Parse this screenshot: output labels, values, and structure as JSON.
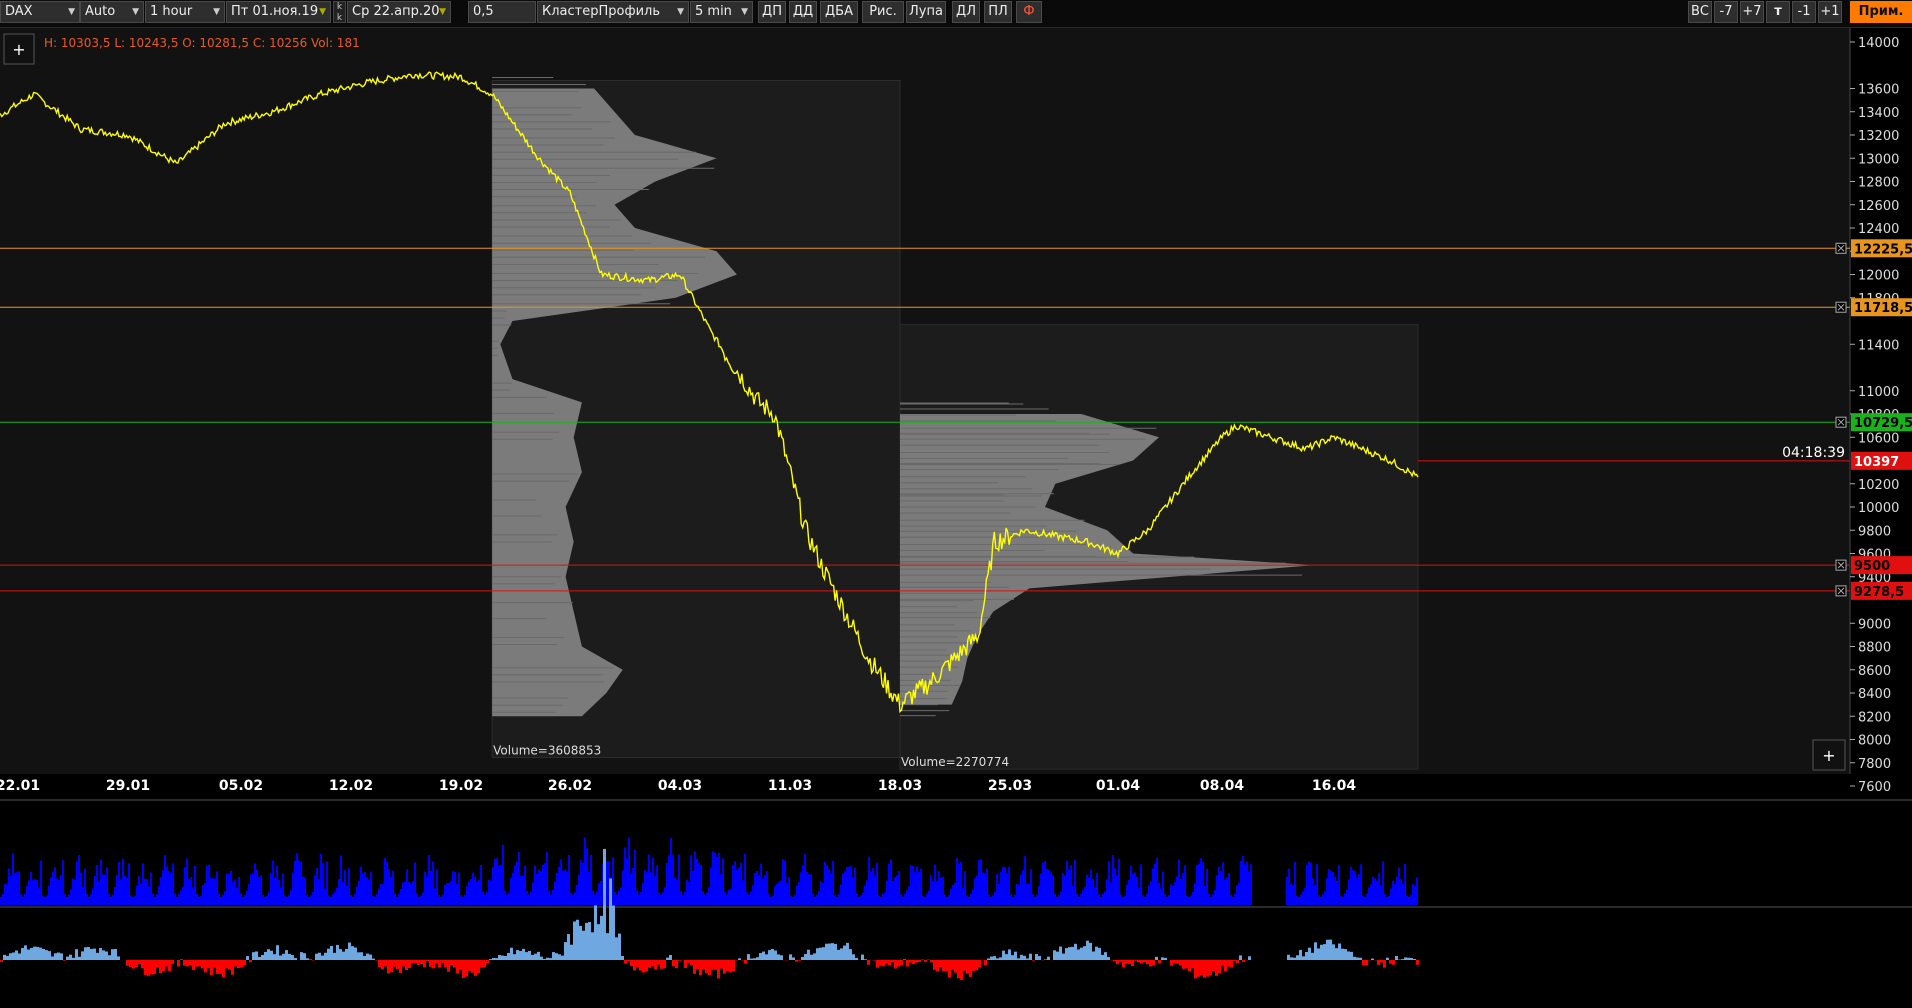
{
  "toolbar": {
    "symbol": "DAX",
    "scale_mode": "Auto",
    "timeframe": "1 hour",
    "date_from": "Пт 01.ноя.19",
    "stepper_top": "k",
    "stepper_bottom": "k",
    "date_to": "Ср 22.апр.20",
    "tick_size": "0,5",
    "chart_type": "КластерПрофиль",
    "cluster_period": "5 min",
    "tools": [
      "ДП",
      "ДД",
      "ДБА",
      "Рис.",
      "Лупа",
      "ДЛ",
      "ПЛ"
    ],
    "font_button": "Ф",
    "right_buttons": [
      "ВС",
      "-7",
      "+7",
      "т",
      "-1",
      "+1"
    ],
    "apply_label": "Прим."
  },
  "info": {
    "ohlc": "H: 10303,5 L: 10243,5 O: 10281,5 C: 10256",
    "volume": "Vol: 181"
  },
  "buttons": {
    "add_top": "+",
    "add_bottom": "+"
  },
  "countdown": "04:18:39",
  "colors": {
    "price_line": "#ffff00",
    "level_orange": "#e8951e",
    "level_green": "#19b319",
    "level_red": "#e01010",
    "profile_gray": "#8c8c8c",
    "volume_blue": "#0000ff",
    "delta_positive": "#6fa8e0",
    "delta_negative": "#ff0000",
    "apply_orange": "#ff7a00"
  },
  "chart_data": {
    "type": "line",
    "instrument": "DAX",
    "ylim": [
      7600,
      14100
    ],
    "y_ticks": [
      14000,
      13600,
      13400,
      13200,
      13000,
      12800,
      12600,
      12400,
      12200,
      12000,
      11800,
      11400,
      11000,
      10800,
      10600,
      10200,
      10000,
      9800,
      9600,
      9400,
      9000,
      8800,
      8600,
      8400,
      8200,
      8000,
      7800,
      7600
    ],
    "x_tick_labels": [
      "22.01",
      "29.01",
      "05.02",
      "12.02",
      "19.02",
      "26.02",
      "04.03",
      "11.03",
      "18.03",
      "25.03",
      "01.04",
      "08.04",
      "16.04"
    ],
    "price_path": {
      "x_dates": [
        "16.01",
        "20.01",
        "23.01",
        "26.01",
        "29.01",
        "01.02",
        "04.02",
        "07.02",
        "10.02",
        "13.02",
        "16.02",
        "19.02",
        "21.02",
        "24.02",
        "26.02",
        "28.02",
        "02.03",
        "04.03",
        "06.03",
        "09.03",
        "10.03",
        "12.03",
        "13.03",
        "16.03",
        "18.03",
        "20.03",
        "23.03",
        "24.03",
        "26.03",
        "30.03",
        "01.04",
        "03.04",
        "06.04",
        "08.04",
        "09.04",
        "14.04",
        "16.04",
        "17.04",
        "20.04",
        "22.04"
      ],
      "y": [
        13450,
        13300,
        13550,
        13250,
        13200,
        12950,
        13300,
        13400,
        13550,
        13650,
        13720,
        13700,
        13550,
        13000,
        12700,
        12000,
        11950,
        12000,
        11500,
        10900,
        10800,
        9800,
        9500,
        8700,
        8300,
        8500,
        8900,
        9700,
        9800,
        9700,
        9600,
        9800,
        10300,
        10600,
        10700,
        10500,
        10600,
        10550,
        10400,
        10256
      ]
    },
    "levels": [
      {
        "label": "12225,5",
        "value": 12225.5,
        "color": "#e8951e"
      },
      {
        "label": "11718,5",
        "value": 11718.5,
        "color": "#e8951e"
      },
      {
        "label": "10729,5",
        "value": 10729.5,
        "color": "#19b319"
      },
      {
        "label": "10397",
        "value": 10397,
        "color": "#e01010"
      },
      {
        "label": "9500",
        "value": 9500,
        "color": "#e01010"
      },
      {
        "label": "9278,5",
        "value": 9278.5,
        "color": "#e01010"
      }
    ],
    "profiles": [
      {
        "volume_label": "Volume=3608853",
        "period": [
          "21.02",
          "18.03"
        ],
        "price_range": [
          8000,
          13600
        ],
        "nodes": [
          {
            "p": 13600,
            "v": 0.25
          },
          {
            "p": 13400,
            "v": 0.3
          },
          {
            "p": 13200,
            "v": 0.35
          },
          {
            "p": 13000,
            "v": 0.55
          },
          {
            "p": 12800,
            "v": 0.4
          },
          {
            "p": 12600,
            "v": 0.3
          },
          {
            "p": 12400,
            "v": 0.35
          },
          {
            "p": 12200,
            "v": 0.55
          },
          {
            "p": 12000,
            "v": 0.6
          },
          {
            "p": 11800,
            "v": 0.45
          },
          {
            "p": 11600,
            "v": 0.05
          },
          {
            "p": 11400,
            "v": 0.02
          },
          {
            "p": 11100,
            "v": 0.05
          },
          {
            "p": 10900,
            "v": 0.22
          },
          {
            "p": 10600,
            "v": 0.2
          },
          {
            "p": 10300,
            "v": 0.22
          },
          {
            "p": 10000,
            "v": 0.18
          },
          {
            "p": 9700,
            "v": 0.2
          },
          {
            "p": 9400,
            "v": 0.18
          },
          {
            "p": 9100,
            "v": 0.2
          },
          {
            "p": 8800,
            "v": 0.22
          },
          {
            "p": 8600,
            "v": 0.32
          },
          {
            "p": 8400,
            "v": 0.28
          },
          {
            "p": 8200,
            "v": 0.22
          }
        ]
      },
      {
        "volume_label": "Volume=2270774",
        "period": [
          "18.03",
          "22.04"
        ],
        "price_range": [
          7900,
          11500
        ],
        "nodes": [
          {
            "p": 10800,
            "v": 0.35
          },
          {
            "p": 10600,
            "v": 0.5
          },
          {
            "p": 10400,
            "v": 0.45
          },
          {
            "p": 10200,
            "v": 0.3
          },
          {
            "p": 10000,
            "v": 0.28
          },
          {
            "p": 9800,
            "v": 0.4
          },
          {
            "p": 9600,
            "v": 0.45
          },
          {
            "p": 9500,
            "v": 0.8
          },
          {
            "p": 9300,
            "v": 0.25
          },
          {
            "p": 9100,
            "v": 0.18
          },
          {
            "p": 8900,
            "v": 0.15
          },
          {
            "p": 8700,
            "v": 0.13
          },
          {
            "p": 8500,
            "v": 0.12
          },
          {
            "p": 8300,
            "v": 0.1
          }
        ]
      }
    ],
    "last_price": 10397
  }
}
